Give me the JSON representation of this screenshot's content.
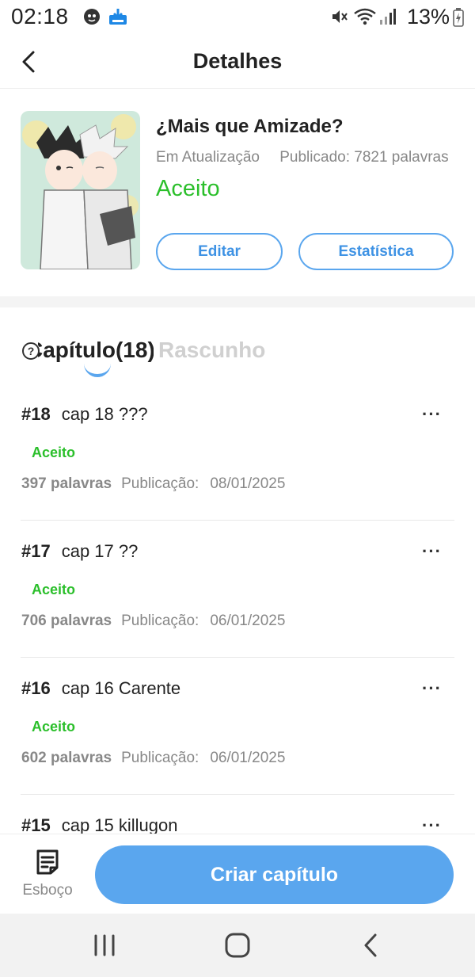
{
  "status_bar": {
    "time": "02:18",
    "battery": "13%",
    "icons": [
      "notification-app-icon",
      "store-download-icon",
      "mute-icon",
      "wifi-icon",
      "signal-icon",
      "battery-charging-icon"
    ]
  },
  "header": {
    "title": "Detalhes",
    "back_icon": "chevron-left-icon"
  },
  "book": {
    "title": "¿Mais que Amizade?",
    "update_status": "Em Atualização",
    "published": "Publicado: 7821 palavras",
    "status": "Aceito",
    "edit_label": "Editar",
    "stats_label": "Estatística"
  },
  "tabs": {
    "help_glyph": "?",
    "active_label": "Capítulo(18)",
    "inactive_label": "Rascunho"
  },
  "chapters": [
    {
      "number": "#18",
      "title": "cap 18 ???",
      "status": "Aceito",
      "words": "397 palavras",
      "pub_label": "Publicação:",
      "date": "08/01/2025",
      "more": "···"
    },
    {
      "number": "#17",
      "title": "cap 17 ??",
      "status": "Aceito",
      "words": "706 palavras",
      "pub_label": "Publicação:",
      "date": "06/01/2025",
      "more": "···"
    },
    {
      "number": "#16",
      "title": "cap 16 Carente",
      "status": "Aceito",
      "words": "602 palavras",
      "pub_label": "Publicação:",
      "date": "06/01/2025",
      "more": "···"
    },
    {
      "number": "#15",
      "title": "cap 15 killugon",
      "status": "",
      "words": "",
      "pub_label": "",
      "date": "",
      "more": "···"
    }
  ],
  "bottom": {
    "draft_label": "Esboço",
    "create_label": "Criar capítulo"
  },
  "colors": {
    "accent": "#5aa6ee",
    "accepted": "#2bbf2b",
    "muted": "#888888"
  }
}
